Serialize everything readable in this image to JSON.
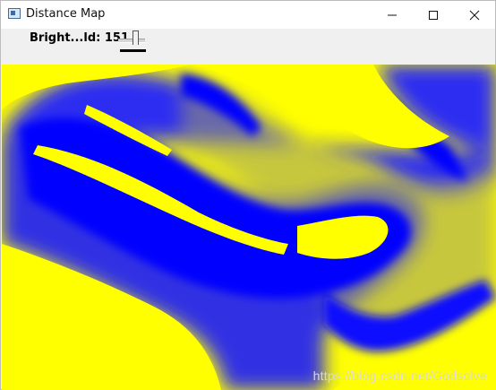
{
  "window": {
    "title": "Distance Map",
    "controls": {
      "minimize_icon": "minimize-icon",
      "maximize_icon": "maximize-icon",
      "close_icon": "close-icon"
    }
  },
  "toolbar": {
    "trackbar_label": "Bright...ld: 151",
    "trackbar_value": 151
  },
  "image": {
    "background_color": "#ffff00",
    "foreground_color": "#0000ff",
    "watermark": "https://blog.csdn.net/Godsolve"
  }
}
